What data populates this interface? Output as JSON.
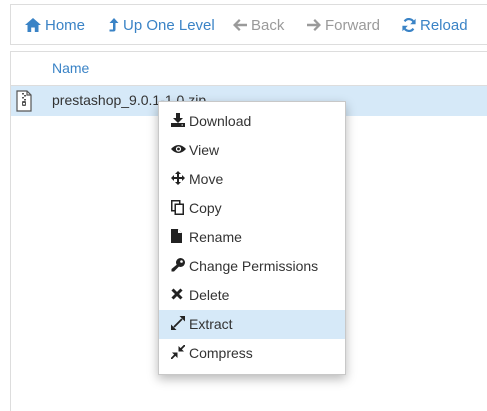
{
  "toolbar": {
    "home": {
      "label": "Home",
      "icon": "home-icon"
    },
    "up_one_level": {
      "label": "Up One Level",
      "icon": "level-up-icon"
    },
    "back": {
      "label": "Back",
      "icon": "arrow-left-icon"
    },
    "forward": {
      "label": "Forward",
      "icon": "arrow-right-icon"
    },
    "reload": {
      "label": "Reload",
      "icon": "refresh-icon"
    }
  },
  "file_list": {
    "columns": [
      "Name"
    ],
    "rows": [
      {
        "name": "prestashop_9.0.1-1.0.zip",
        "icon": "zip-file-icon",
        "selected": true
      }
    ]
  },
  "context_menu": {
    "items": [
      {
        "label": "Download",
        "icon": "download-icon"
      },
      {
        "label": "View",
        "icon": "eye-icon"
      },
      {
        "label": "Move",
        "icon": "move-icon"
      },
      {
        "label": "Copy",
        "icon": "copy-icon"
      },
      {
        "label": "Rename",
        "icon": "file-icon"
      },
      {
        "label": "Change Permissions",
        "icon": "key-icon"
      },
      {
        "label": "Delete",
        "icon": "delete-icon"
      },
      {
        "label": "Extract",
        "icon": "expand-icon",
        "highlighted": true
      },
      {
        "label": "Compress",
        "icon": "compress-icon"
      }
    ]
  },
  "colors": {
    "link": "#3a83c6",
    "disabled": "#9a9a9a",
    "selection": "#d6e9f8",
    "text": "#333333"
  }
}
